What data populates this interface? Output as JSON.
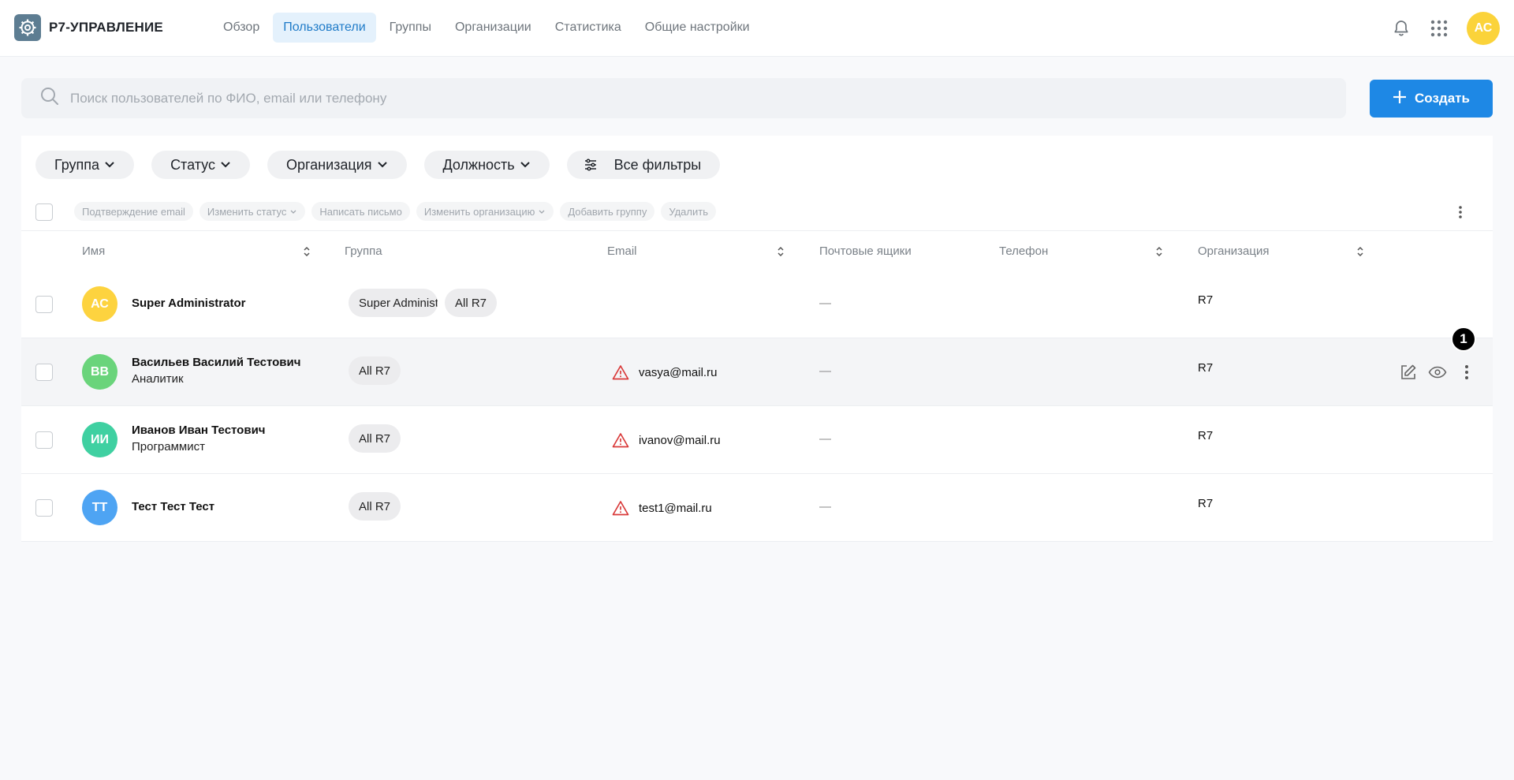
{
  "app": {
    "logo_text": "Р7-УПРАВЛЕНИЕ"
  },
  "nav": {
    "items": [
      {
        "label": "Обзор",
        "active": false
      },
      {
        "label": "Пользователи",
        "active": true
      },
      {
        "label": "Группы",
        "active": false
      },
      {
        "label": "Организации",
        "active": false
      },
      {
        "label": "Статистика",
        "active": false
      },
      {
        "label": "Общие настройки",
        "active": false
      }
    ]
  },
  "header": {
    "user_initials": "АС"
  },
  "search": {
    "placeholder": "Поиск пользователей по ФИО, email или телефону"
  },
  "create_button": {
    "label": "Создать"
  },
  "filters": {
    "group": "Группа",
    "status": "Статус",
    "organization": "Организация",
    "position": "Должность",
    "all": "Все фильтры"
  },
  "bulk_actions": {
    "confirm_email": "Подтверждение email",
    "change_status": "Изменить статус",
    "write_letter": "Написать письмо",
    "change_org": "Изменить организацию",
    "add_group": "Добавить группу",
    "delete": "Удалить"
  },
  "table": {
    "headers": {
      "name": "Имя",
      "group": "Группа",
      "email": "Email",
      "mailboxes": "Почтовые ящики",
      "phone": "Телефон",
      "organization": "Организация"
    },
    "rows": [
      {
        "initials": "АС",
        "avatar_color": "#fdd33f",
        "name": "Super Administrator",
        "position": "",
        "groups": [
          "Super Administrators",
          "All R7"
        ],
        "email": "",
        "mailboxes": "—",
        "organization": "R7"
      },
      {
        "initials": "ВВ",
        "avatar_color": "#6ad47b",
        "name": "Васильев Василий Тестович",
        "position": "Аналитик",
        "groups": [
          "All R7"
        ],
        "email": "vasya@mail.ru",
        "mailboxes": "—",
        "organization": "R7"
      },
      {
        "initials": "ИИ",
        "avatar_color": "#3fd0a1",
        "name": "Иванов Иван Тестович",
        "position": "Программист",
        "groups": [
          "All R7"
        ],
        "email": "ivanov@mail.ru",
        "mailboxes": "—",
        "organization": "R7"
      },
      {
        "initials": "ТТ",
        "avatar_color": "#4ea4f3",
        "name": "Тест Тест Тест",
        "position": "",
        "groups": [
          "All R7"
        ],
        "email": "test1@mail.ru",
        "mailboxes": "—",
        "organization": "R7"
      }
    ]
  },
  "annotation_marker": "1",
  "colors": {
    "accent": "#1e88e5",
    "active_nav_bg": "#e4f1fc",
    "warning": "#d93a3a"
  }
}
